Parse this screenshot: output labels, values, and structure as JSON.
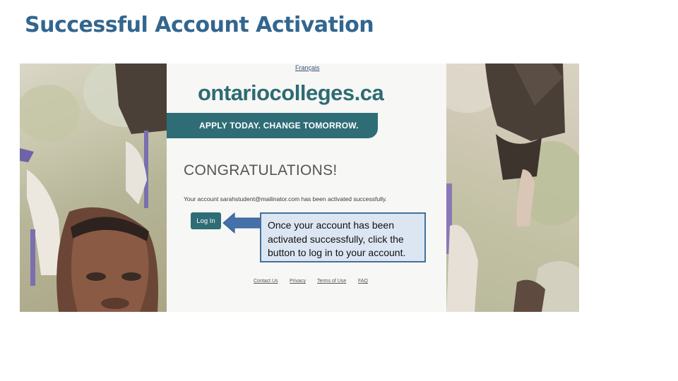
{
  "slide": {
    "title": "Successful Account Activation"
  },
  "page": {
    "language_link": "Français",
    "logo": "ontariocolleges.ca",
    "banner": "APPLY TODAY. CHANGE TOMORROW.",
    "heading": "CONGRATULATIONS!",
    "message": "Your account sarahstudent@mailinator.com has been activated successfully.",
    "login_button": "Log In",
    "footer_links": [
      "Contact Us",
      "Privacy",
      "Terms of Use",
      "FAQ"
    ]
  },
  "callout": {
    "text": "Once your account has been activated successfully, click the  button to log in to your account."
  },
  "colors": {
    "title": "#33668f",
    "brand_teal": "#2e6d76",
    "callout_fill": "#dce6f2",
    "callout_border": "#41719c",
    "arrow": "#4472a8"
  }
}
